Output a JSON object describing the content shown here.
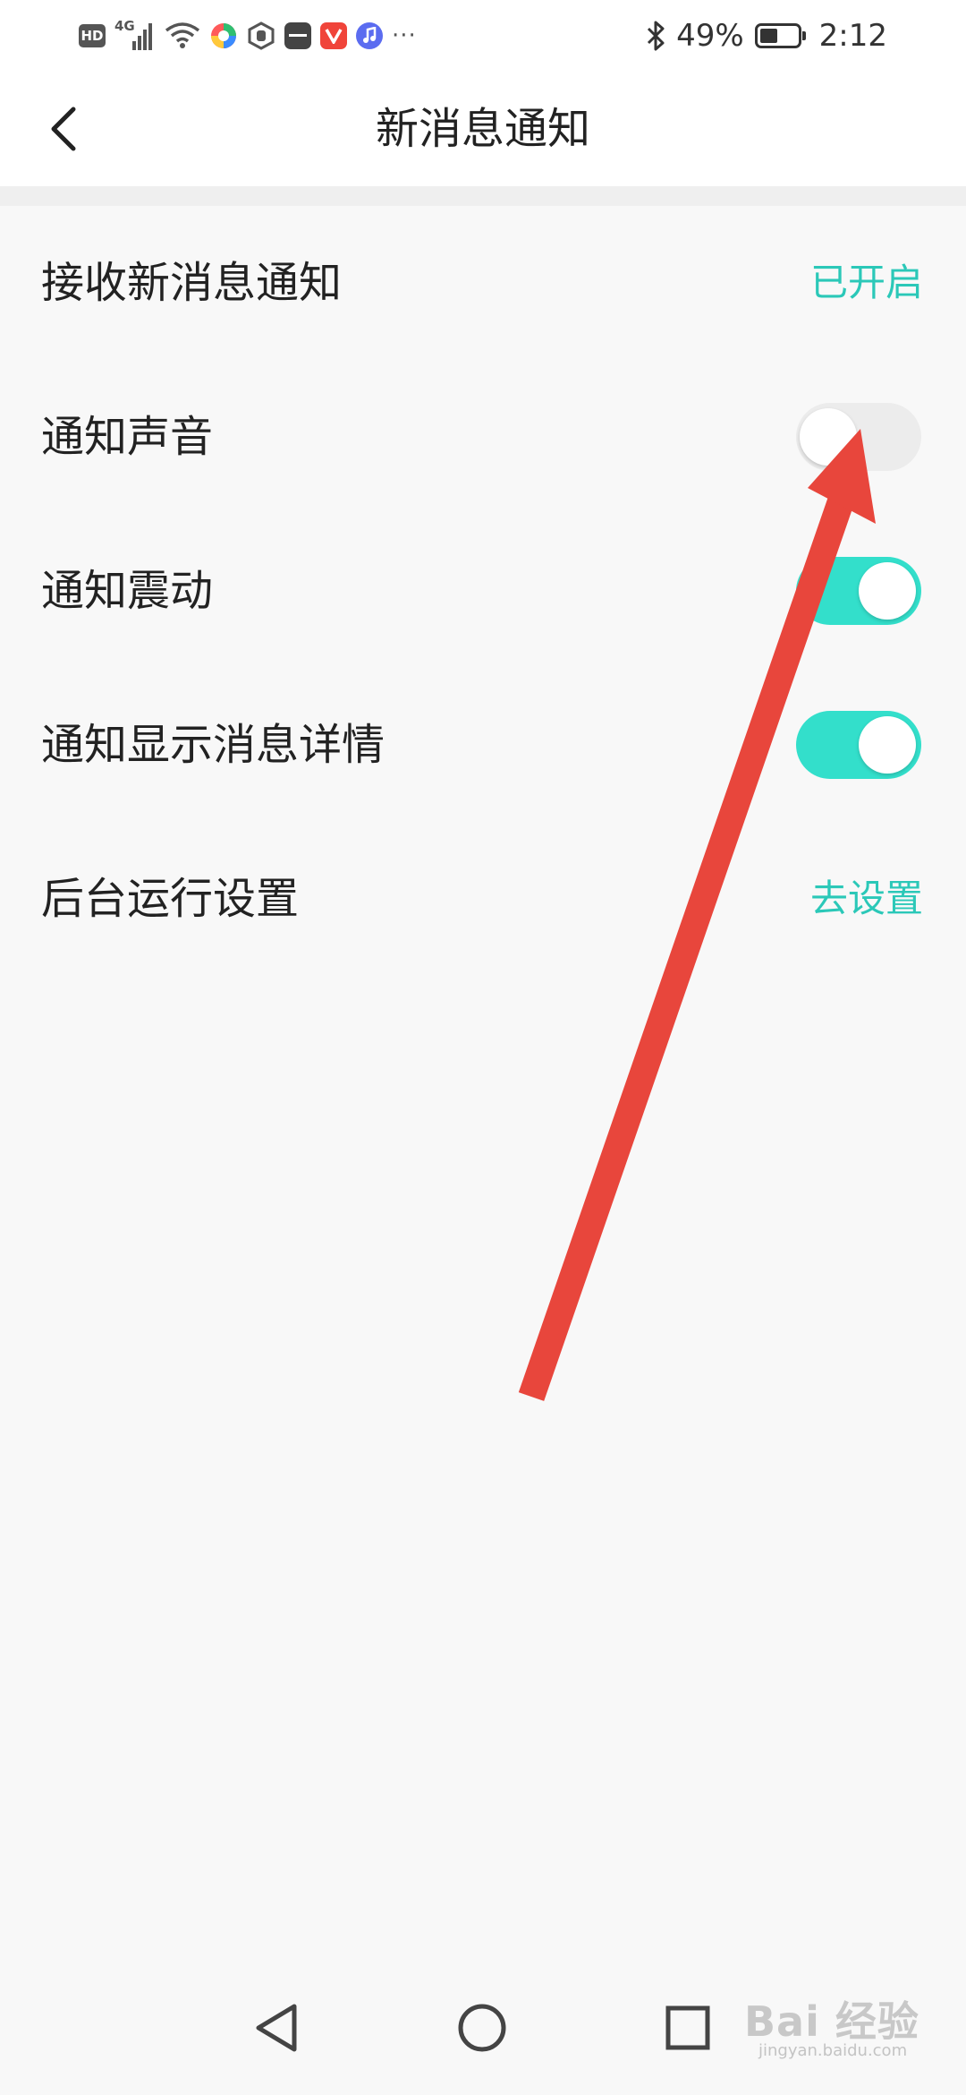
{
  "status_bar": {
    "hd_label": "HD",
    "network_label": "4G",
    "more_indicator": "···",
    "battery_percent": "49%",
    "battery_level": 0.49,
    "time": "2:12",
    "icons": [
      "hd-icon",
      "signal-icon",
      "wifi-icon",
      "app-colorful-icon",
      "app-shield-icon",
      "huawei-app-icon",
      "video-app-icon",
      "music-app-icon",
      "bluetooth-icon",
      "battery-icon"
    ]
  },
  "header": {
    "title": "新消息通知",
    "back_icon": "chevron-left-icon"
  },
  "settings": {
    "receive": {
      "label": "接收新消息通知",
      "status": "已开启"
    },
    "sound": {
      "label": "通知声音",
      "enabled": false
    },
    "vibrate": {
      "label": "通知震动",
      "enabled": true
    },
    "details": {
      "label": "通知显示消息详情",
      "enabled": true
    },
    "background": {
      "label": "后台运行设置",
      "action": "去设置"
    }
  },
  "nav_bar": {
    "icons": [
      "back-triangle-icon",
      "home-circle-icon",
      "recents-square-icon"
    ]
  },
  "watermark": {
    "text": "Bai 经验",
    "sub": "jingyan.baidu.com"
  },
  "colors": {
    "accent": "#2bc8b8",
    "toggle_on": "#33dfcb",
    "toggle_off": "#ececec",
    "arrow": "#e8463c",
    "background": "#f8f8f8"
  }
}
